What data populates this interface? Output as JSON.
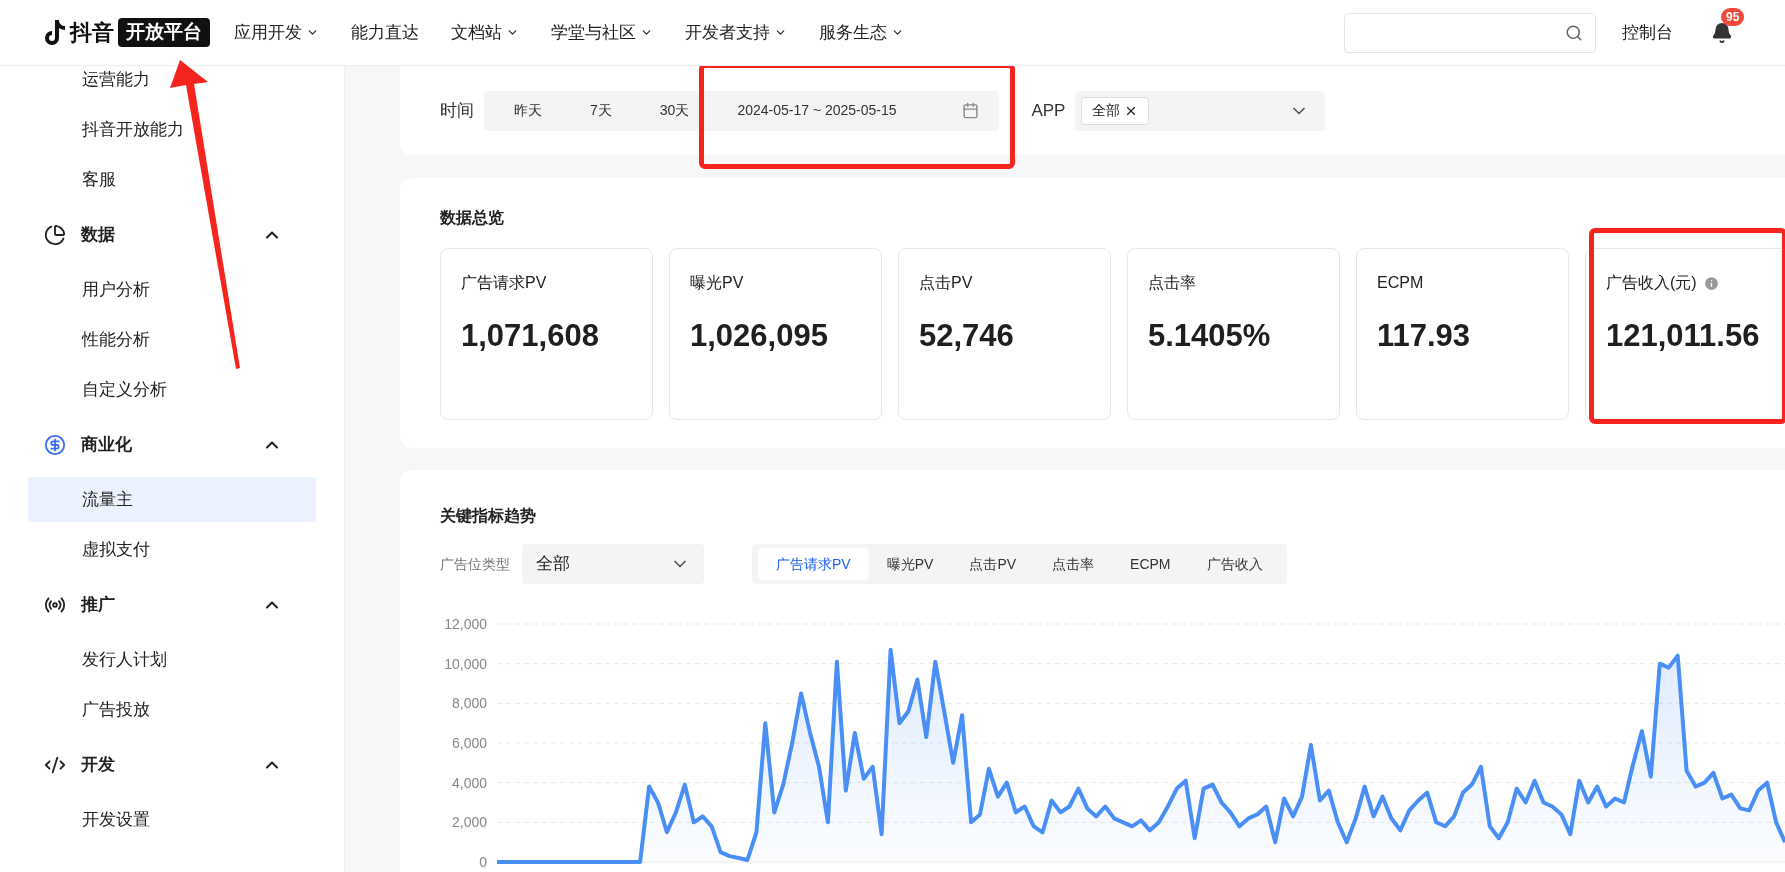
{
  "header": {
    "logo": {
      "wordmark": "抖音",
      "badge": "开放平台",
      "annotated": true
    },
    "nav": [
      {
        "label": "应用开发",
        "has_menu": true
      },
      {
        "label": "能力直达",
        "has_menu": false
      },
      {
        "label": "文档站",
        "has_menu": true
      },
      {
        "label": "学堂与社区",
        "has_menu": true
      },
      {
        "label": "开发者支持",
        "has_menu": true
      },
      {
        "label": "服务生态",
        "has_menu": true
      }
    ],
    "console": "控制台",
    "notification_count": "95"
  },
  "sidebar": {
    "groups": [
      {
        "items": [
          {
            "label": "运营能力",
            "selected": false
          },
          {
            "label": "抖音开放能力",
            "selected": false
          },
          {
            "label": "客服",
            "selected": false
          }
        ]
      },
      {
        "title": "数据",
        "expanded": true,
        "items": [
          {
            "label": "用户分析",
            "selected": false
          },
          {
            "label": "性能分析",
            "selected": false
          },
          {
            "label": "自定义分析",
            "selected": false
          }
        ]
      },
      {
        "title": "商业化",
        "expanded": true,
        "items": [
          {
            "label": "流量主",
            "selected": true
          },
          {
            "label": "虚拟支付",
            "selected": false
          }
        ]
      },
      {
        "title": "推广",
        "expanded": true,
        "items": [
          {
            "label": "发行人计划",
            "selected": false
          },
          {
            "label": "广告投放",
            "selected": false
          }
        ]
      },
      {
        "title": "开发",
        "expanded": true,
        "items": [
          {
            "label": "开发设置",
            "selected": false
          }
        ]
      }
    ]
  },
  "filters": {
    "time_label": "时间",
    "quick_ranges": [
      {
        "label": "昨天",
        "selected": false
      },
      {
        "label": "7天",
        "selected": false
      },
      {
        "label": "30天",
        "selected": false
      }
    ],
    "date_range": {
      "value": "2024-05-17 ~ 2025-05-15",
      "annotated": true
    },
    "app_label": "APP",
    "app_tags": [
      "全部"
    ]
  },
  "overview": {
    "title": "数据总览",
    "metrics": [
      {
        "label": "广告请求PV",
        "value": "1,071,608",
        "info": false,
        "annotated": false
      },
      {
        "label": "曝光PV",
        "value": "1,026,095",
        "info": false,
        "annotated": false
      },
      {
        "label": "点击PV",
        "value": "52,746",
        "info": false,
        "annotated": false
      },
      {
        "label": "点击率",
        "value": "5.1405%",
        "info": false,
        "annotated": false
      },
      {
        "label": "ECPM",
        "value": "117.93",
        "info": false,
        "annotated": false
      },
      {
        "label": "广告收入(元)",
        "value": "121,011.56",
        "info": true,
        "annotated": true
      }
    ]
  },
  "trend": {
    "title": "关键指标趋势",
    "slot_type_label": "广告位类型",
    "slot_type_value": "全部",
    "metric_tabs": [
      {
        "label": "广告请求PV",
        "selected": true
      },
      {
        "label": "曝光PV",
        "selected": false
      },
      {
        "label": "点击PV",
        "selected": false
      },
      {
        "label": "点击率",
        "selected": false
      },
      {
        "label": "ECPM",
        "selected": false
      },
      {
        "label": "广告收入",
        "selected": false
      }
    ],
    "chart_data": {
      "type": "area",
      "grid": true,
      "ylim": [
        0,
        12000
      ],
      "yticks": [
        {
          "value": 0,
          "label": "0"
        },
        {
          "value": 2000,
          "label": "2,000"
        },
        {
          "value": 4000,
          "label": "4,000"
        },
        {
          "value": 6000,
          "label": "6,000"
        },
        {
          "value": 8000,
          "label": "8,000"
        },
        {
          "value": 10000,
          "label": "10,000"
        },
        {
          "value": 12000,
          "label": "12,000"
        }
      ],
      "values": [
        0,
        0,
        0,
        0,
        0,
        0,
        0,
        0,
        0,
        0,
        0,
        0,
        0,
        0,
        0,
        0,
        0,
        3800,
        3000,
        1500,
        2500,
        3900,
        2000,
        2300,
        1800,
        500,
        300,
        200,
        100,
        1500,
        7000,
        2500,
        3900,
        6000,
        8500,
        6500,
        4800,
        2000,
        10100,
        3600,
        6500,
        4200,
        4800,
        1400,
        10700,
        7000,
        7600,
        9200,
        6300,
        10100,
        7600,
        5000,
        7400,
        2000,
        2400,
        4700,
        3300,
        4000,
        2500,
        2800,
        1800,
        1500,
        3100,
        2500,
        2800,
        3700,
        2700,
        2300,
        2800,
        2200,
        2000,
        1800,
        2100,
        1600,
        2000,
        2800,
        3700,
        4100,
        1200,
        3700,
        3900,
        3000,
        2500,
        1800,
        2200,
        2400,
        2800,
        1000,
        3200,
        2300,
        3300,
        5900,
        3100,
        3600,
        2000,
        1000,
        2200,
        3800,
        2300,
        3300,
        2200,
        1600,
        2600,
        3100,
        3500,
        2000,
        1800,
        2300,
        3500,
        3900,
        4800,
        1800,
        1200,
        2000,
        3700,
        3000,
        4100,
        3000,
        2800,
        2400,
        1400,
        4100,
        3000,
        3800,
        2800,
        3200,
        3000,
        4900,
        6600,
        4300,
        10000,
        9800,
        10400,
        4600,
        3800,
        4000,
        4500,
        3200,
        3400,
        2700,
        2600,
        3600,
        4000,
        2000,
        1000
      ]
    }
  }
}
